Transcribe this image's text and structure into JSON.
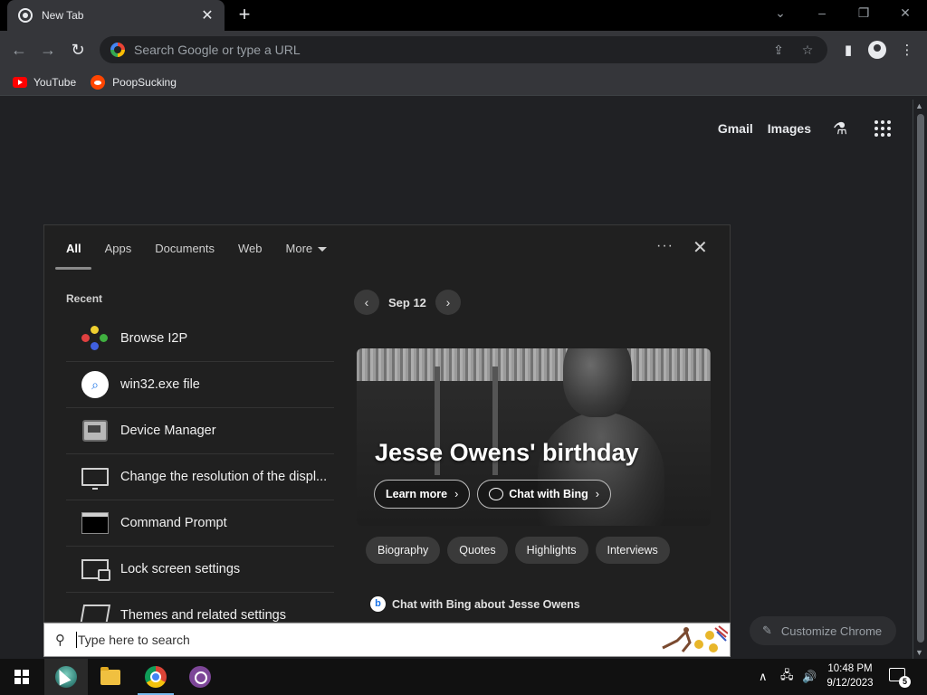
{
  "browser": {
    "tab_title": "New Tab",
    "omnibox_placeholder": "Search Google or type a URL",
    "bookmarks": [
      {
        "label": "YouTube",
        "icon": "youtube-icon"
      },
      {
        "label": "PoopSucking",
        "icon": "reddit-icon"
      }
    ]
  },
  "ntp": {
    "links": [
      "Gmail",
      "Images"
    ],
    "customize_label": "Customize Chrome"
  },
  "search_panel": {
    "tabs": [
      "All",
      "Apps",
      "Documents",
      "Web",
      "More"
    ],
    "recent_label": "Recent",
    "recent_items": [
      {
        "label": "Browse I2P",
        "icon": "i2p-icon"
      },
      {
        "label": "win32.exe file",
        "icon": "search-icon"
      },
      {
        "label": "Device Manager",
        "icon": "device-manager-icon"
      },
      {
        "label": "Change the resolution of the displ...",
        "icon": "monitor-icon"
      },
      {
        "label": "Command Prompt",
        "icon": "command-prompt-icon"
      },
      {
        "label": "Lock screen settings",
        "icon": "lock-screen-icon"
      },
      {
        "label": "Themes and related settings",
        "icon": "themes-icon"
      }
    ],
    "date_label": "Sep 12",
    "hero_title": "Jesse Owens' birthday",
    "hero_buttons": [
      "Learn more",
      "Chat with Bing"
    ],
    "chips": [
      "Biography",
      "Quotes",
      "Highlights",
      "Interviews"
    ],
    "bing_chat_label": "Chat with Bing about Jesse Owens",
    "bing_logo_letter": "b"
  },
  "searchbox": {
    "placeholder": "Type here to search"
  },
  "taskbar": {
    "apps": [
      "start-button",
      "i2p-app",
      "file-explorer",
      "chrome",
      "tor-browser"
    ],
    "clock_time": "10:48 PM",
    "clock_date": "9/12/2023",
    "notification_count": "5"
  },
  "colors": {
    "page_bg": "#202124",
    "toolbar_bg": "#35363a",
    "panel_bg": "#202020",
    "taskbar_bg": "#111111"
  }
}
